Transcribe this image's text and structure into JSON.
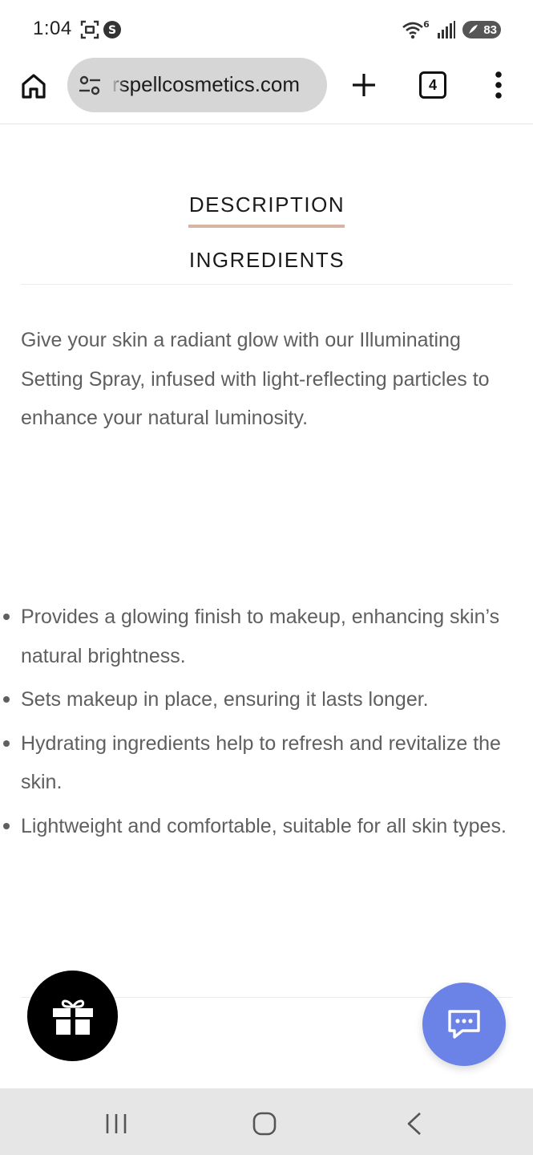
{
  "status_bar": {
    "time": "1:04",
    "wifi_badge": "6",
    "battery_level": "83",
    "icons": [
      "screenshot-icon",
      "s-app-icon",
      "wifi-icon",
      "signal-icon",
      "battery-icon"
    ]
  },
  "browser": {
    "url": "rspellcosmetics.com",
    "tab_count": "4",
    "icons": [
      "home-icon",
      "site-settings-icon",
      "plus-icon",
      "tab-switcher-icon",
      "more-vert-icon"
    ]
  },
  "product": {
    "tabs": [
      {
        "label": "DESCRIPTION",
        "active": true
      },
      {
        "label": "INGREDIENTS",
        "active": false
      }
    ],
    "description": "Give your skin a radiant glow with our Illuminating Setting Spray, infused with light-reflecting particles to enhance your natural luminosity.",
    "benefits": [
      "Provides a glowing finish to makeup, enhancing skin’s natural brightness.",
      "Sets makeup in place, ensuring it lasts longer.",
      "Hydrating ingredients help to refresh and revitalize the skin.",
      "Lightweight and comfortable, suitable for all skin types."
    ]
  },
  "floating": {
    "gift_icon": "gift-icon",
    "chat_icon": "chat-icon"
  },
  "colors": {
    "tab_underline": "#d7b4a3",
    "chat_button": "#6b82e6",
    "gift_button": "#000000",
    "body_text": "#5f5f5f",
    "nav_bar": "#e6e6e6"
  },
  "nav_bar": {
    "icons": [
      "recents-icon",
      "home-circle-icon",
      "back-icon"
    ]
  }
}
